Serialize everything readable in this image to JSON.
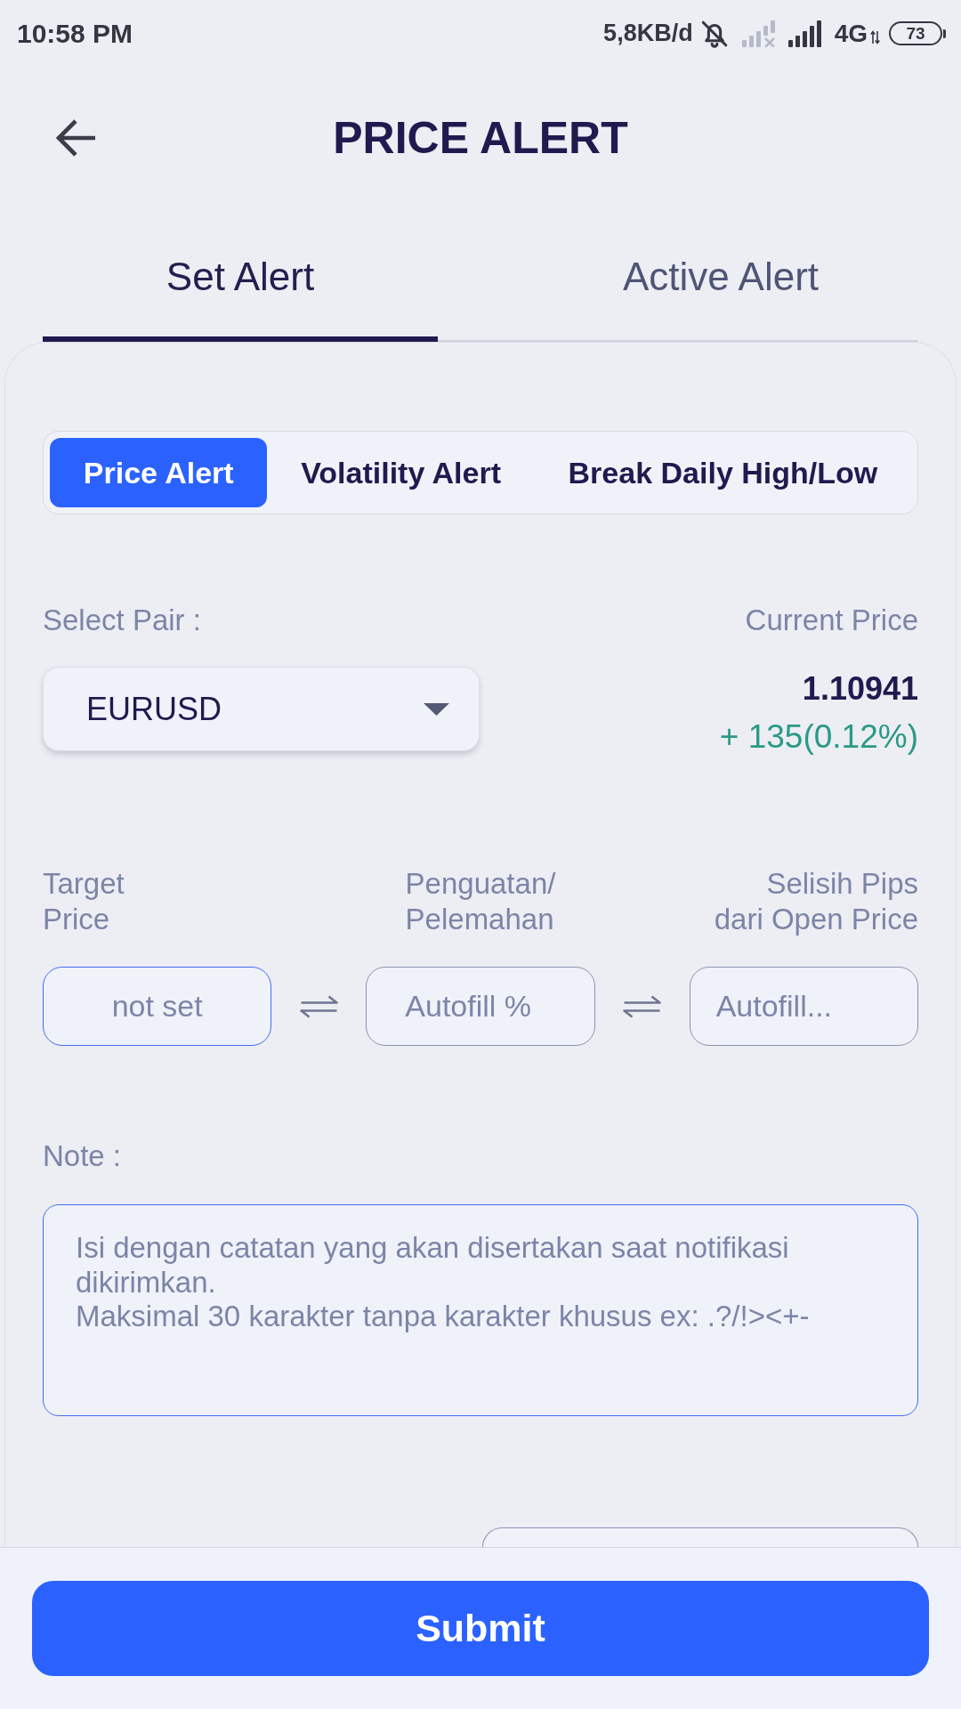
{
  "status_bar": {
    "time": "10:58 PM",
    "data_rate": "5,8KB/d",
    "network_type": "4G",
    "battery": "73"
  },
  "header": {
    "title": "PRICE ALERT"
  },
  "tabs": [
    {
      "label": "Set Alert",
      "selected": true
    },
    {
      "label": "Active Alert",
      "selected": false
    }
  ],
  "alert_types": [
    {
      "label": "Price Alert",
      "selected": true
    },
    {
      "label": "Volatility Alert",
      "selected": false
    },
    {
      "label": "Break Daily High/Low",
      "selected": false
    }
  ],
  "pair": {
    "label": "Select Pair :",
    "value": "EURUSD"
  },
  "current_price": {
    "label": "Current Price",
    "price": "1.10941",
    "change": "+ 135(0.12%)",
    "rising": true
  },
  "target_fields": [
    {
      "label": "Target\nPrice",
      "placeholder": "not set",
      "disabled": false
    },
    {
      "label": "Penguatan/\nPelemahan",
      "placeholder": "Autofill %",
      "disabled": true
    },
    {
      "label": "Selisih Pips\ndari Open Price",
      "placeholder": "Autofill...",
      "disabled": true
    }
  ],
  "note": {
    "label": "Note :",
    "placeholder": "Isi dengan catatan yang akan disertakan saat notifikasi dikirimkan.\nMaksimal 30 karakter tanpa karakter khusus ex: .?/!><+-"
  },
  "submit_button": {
    "label": "Submit"
  }
}
